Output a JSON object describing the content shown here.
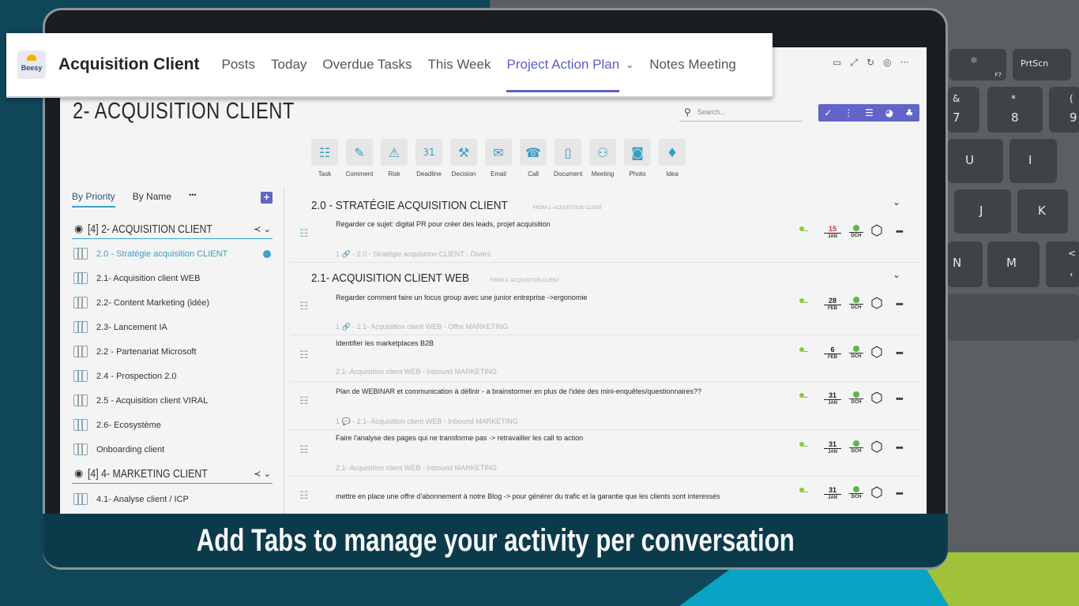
{
  "header": {
    "logo_text": "Beesy",
    "app_title": "Acquisition Client",
    "tabs": [
      {
        "label": "Posts"
      },
      {
        "label": "Today"
      },
      {
        "label": "Overdue Tasks"
      },
      {
        "label": "This Week"
      },
      {
        "label": "Project Action Plan"
      },
      {
        "label": "Notes Meeting"
      }
    ],
    "active_tab": "Project Action Plan",
    "accent_color": "#5b5fc7"
  },
  "window_icons": [
    "chat-icon",
    "expand-icon",
    "refresh-icon",
    "globe-icon",
    "more-icon"
  ],
  "keyboard": {
    "keys": [
      "F7",
      "PrtScn",
      "&",
      "7",
      "*",
      "8",
      "(",
      "9",
      "U",
      "I",
      "J",
      "K",
      "N",
      "M",
      "<",
      ","
    ]
  },
  "page": {
    "title": "2- ACQUISITION CLIENT",
    "search_placeholder": "Search...",
    "toolset_icons": [
      "check-circle-icon",
      "org-chart-icon",
      "filter-sliders-icon",
      "pie-chart-icon",
      "team-icon"
    ]
  },
  "quick_actions": [
    {
      "label": "Task",
      "icon": "task-icon"
    },
    {
      "label": "Comment",
      "icon": "pen-icon"
    },
    {
      "label": "Risk",
      "icon": "warning-icon"
    },
    {
      "label": "Deadline",
      "icon": "calendar-icon"
    },
    {
      "label": "Decision",
      "icon": "gavel-icon"
    },
    {
      "label": "Email",
      "icon": "envelope-icon"
    },
    {
      "label": "Call",
      "icon": "phone-icon"
    },
    {
      "label": "Document",
      "icon": "document-icon"
    },
    {
      "label": "Meeting",
      "icon": "meeting-icon"
    },
    {
      "label": "Photo",
      "icon": "camera-icon"
    },
    {
      "label": "Idea",
      "icon": "lightbulb-icon"
    }
  ],
  "sidebar": {
    "tabs": [
      "By Priority",
      "By Name"
    ],
    "more": "•••",
    "groups": [
      {
        "label": "[4]  2- ACQUISITION CLIENT"
      },
      {
        "label": "[4]  4- MARKETING CLIENT"
      }
    ],
    "items": [
      {
        "label": "2.0 - Stratégie acquisition CLIENT"
      },
      {
        "label": "2.1- Acquisition client WEB"
      },
      {
        "label": "2.2- Content Marketing (idée)"
      },
      {
        "label": "2.3- Lancement IA"
      },
      {
        "label": "2.2 - Partenariat Microsoft"
      },
      {
        "label": "2.4 - Prospection 2.0"
      },
      {
        "label": "2.5 - Acquisition client VIRAL"
      },
      {
        "label": "2.6- Ecosystème"
      },
      {
        "label": "Onboarding client"
      },
      {
        "label": "4.1- Analyse client / ICP"
      }
    ]
  },
  "sections": [
    {
      "title": "2.0 - STRATÉGIE ACQUISITION CLIENT",
      "from": "FROM 2- ACQUISITION CLIENT"
    },
    {
      "title": "2.1- ACQUISITION CLIENT WEB",
      "from": "FROM 2- ACQUISITION CLIENT"
    }
  ],
  "tasks": [
    {
      "text": "Regarder ce sujet: digital PR pour créer des leads, projet acquisition",
      "meta": "1 🔗 - 2.0 - Stratégie acquisition CLIENT - Divers",
      "day": "15",
      "month": "JAN",
      "owner": "DCH"
    },
    {
      "text": "Regarder comment faire un focus group avec une junior entreprise ->ergonomie",
      "meta": "1 🔗 - 2.1- Acquisition client WEB - Offre MARKETING",
      "day": "28",
      "month": "FEB",
      "owner": "DCH"
    },
    {
      "text": "Identifier les marketplaces B2B",
      "meta": "2.1- Acquisition client WEB - Inbound MARKETING",
      "day": "6",
      "month": "FEB",
      "owner": "DCH"
    },
    {
      "text": "Plan de WEBINAR et communication à définir - a brainstormer en plus de l'idée des mini-enquêtes/questionnaires??",
      "meta": "1 💬 - 2.1- Acquisition client WEB - Inbound MARKETING",
      "day": "31",
      "month": "JAN",
      "owner": "DCH"
    },
    {
      "text": "Faire l'analyse des pages qui ne transforme pas -> retravailler les call to action",
      "meta": "2.1- Acquisition client WEB - Inbound MARKETING",
      "day": "31",
      "month": "JAN",
      "owner": "DCH"
    },
    {
      "text": "mettre en place une offre d'abonnement à notre Blog -> pour générer du trafic et la garantie que les clients sont interessés",
      "meta": "",
      "day": "31",
      "month": "JAN",
      "owner": "DCH"
    }
  ],
  "caption": "Add Tabs to manage your activity per conversation"
}
